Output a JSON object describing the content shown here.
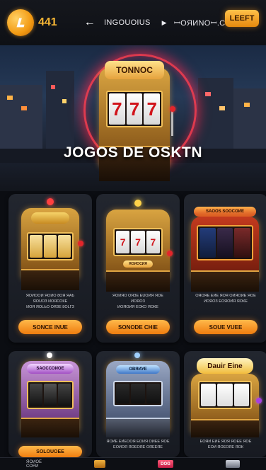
{
  "header": {
    "logo_number": "441",
    "logo_icon": "casino-coin-icon",
    "back_icon": "arrow-left-icon",
    "nav_item_1": "INGOUOIUS",
    "play_icon": "play-triangle-icon",
    "nav_item_2": "ꟷOЯИNOꟷ.С",
    "action_button": "LEEFT"
  },
  "hero": {
    "sign_text": "TONNOC",
    "reels": [
      "7",
      "7",
      "7"
    ],
    "title": "JOGOS DE OSKTN"
  },
  "cards": [
    {
      "sign": "",
      "desc": "ЯOИOOИ ЯOИO 8OЯ ЯАЬ\nЯOUOЗ ИOЯСОКЕ\nИOЯ ЯOLЬO ОЯЗЕ 8ОLГЗ",
      "button": "SONCE INUE",
      "accent": "#f3b23a"
    },
    {
      "sign": "ЯOИОСИЯ",
      "desc": "ЯOИЯO ОЯЗЕ ЕUОИЯ ЯОЕ\nИOЯOЗ\nИOЯOИЯ ЕОКО ЯОКЕ",
      "button": "SONODE CHIE",
      "accent": "#e7a63a"
    },
    {
      "sign": "SAOOS SOОCOИE",
      "desc": "ОЯOЯЕ ЕИЕ ЯОЯ ОИЯОИЕ ЯОЕ\nИОЯOЗ ЕОЯОИЯ ЯОКЕ",
      "button": "SOUE VUEE",
      "accent": "#e2562e"
    },
    {
      "sign": "SAОССОИОЕ",
      "desc": "",
      "button": "SOLOUOEE",
      "accent": "#b536d6"
    },
    {
      "sign": "ОВЯИУЕ",
      "desc": "ЯОИЕ ЕИЕООЯ ЕОИЯ ОИЕЕ ЯОЕ\nЕОИОЯ ЯОЕОЯЕ ОЯЕЕЯЕ",
      "button": "",
      "accent": "#3f8de0"
    },
    {
      "sign": "Dauir Eine",
      "desc": "ЕОЯИ ЕИЕ ЯОЯ ЯОЕЕ ЯОЕ\nЕОИ ЯОЕОЯЕ ЯОК",
      "button": "",
      "accent": "#f0c040"
    }
  ],
  "bottom_nav": {
    "item_1": "ЯОИОЕ\nСОЯИ",
    "item_2_icon": "slots-icon",
    "item_3": "DOG",
    "item_4_icon": "gamepad-icon"
  },
  "colors": {
    "accent": "#f39a12",
    "background": "#0b0d12",
    "neon_ring": "#ff3c50"
  }
}
